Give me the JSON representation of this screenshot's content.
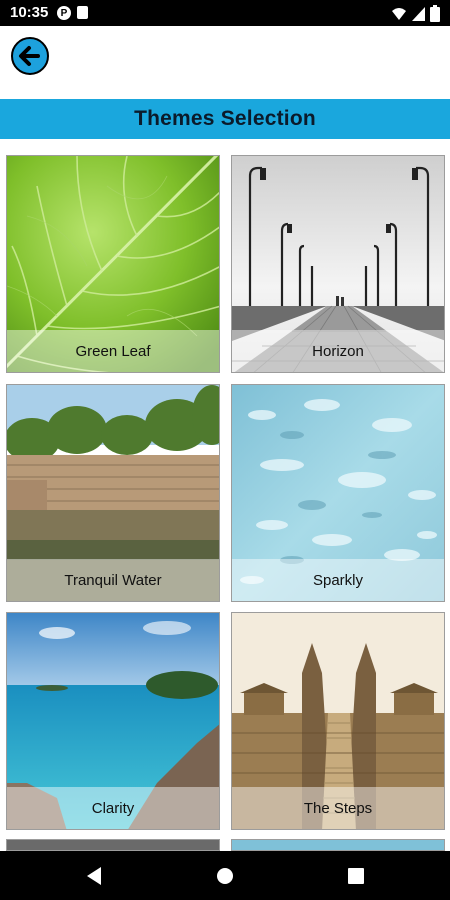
{
  "status_bar": {
    "time": "10:35",
    "notification_badge": "P"
  },
  "header": {
    "title": "Themes Selection"
  },
  "themes": [
    {
      "label": "Green Leaf"
    },
    {
      "label": "Horizon"
    },
    {
      "label": "Tranquil Water"
    },
    {
      "label": "Sparkly"
    },
    {
      "label": "Clarity"
    },
    {
      "label": "The Steps"
    }
  ],
  "colors": {
    "accent": "#1aa7dd",
    "status_bar": "#000000"
  },
  "icons": {
    "back": "back-arrow-icon",
    "wifi": "wifi-icon",
    "signal": "signal-icon",
    "battery": "battery-icon"
  }
}
